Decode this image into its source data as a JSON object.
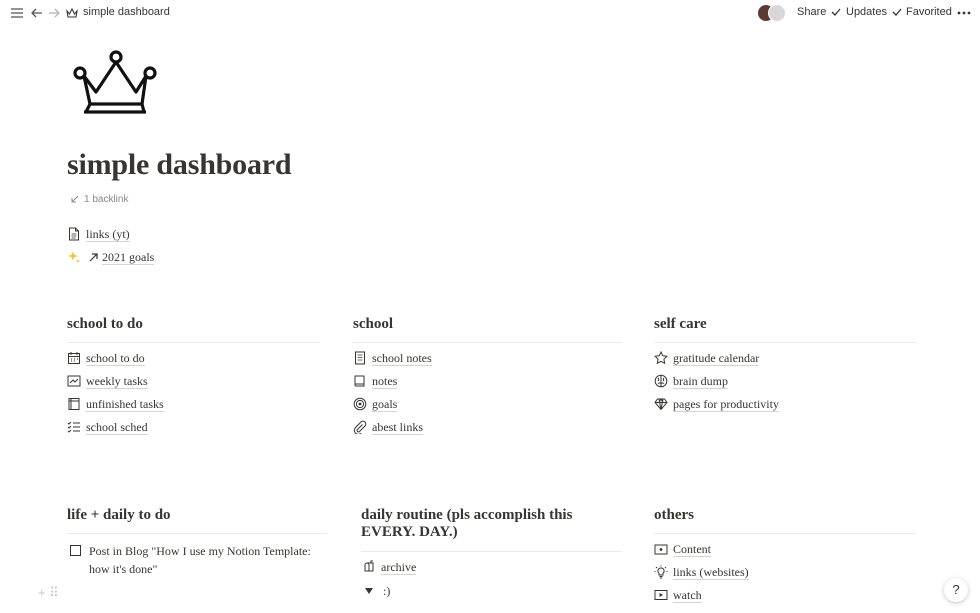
{
  "topbar": {
    "breadcrumb": "simple dashboard",
    "share": "Share",
    "updates": "Updates",
    "favorited": "Favorited"
  },
  "page": {
    "title": "simple dashboard",
    "backlink": "1 backlink",
    "links": [
      {
        "icon": "document-icon",
        "label": "links (yt)"
      },
      {
        "icon": "sparkles-icon",
        "label": "2021 goals"
      }
    ]
  },
  "sections": {
    "school_todo": {
      "heading": "school  to do",
      "items": [
        {
          "icon": "calendar-icon",
          "label": "school to do"
        },
        {
          "icon": "chart-icon",
          "label": "weekly tasks"
        },
        {
          "icon": "notebook-icon",
          "label": "unfinished tasks"
        },
        {
          "icon": "checklist-icon",
          "label": "school sched"
        }
      ]
    },
    "school": {
      "heading": "school",
      "items": [
        {
          "icon": "document-icon",
          "label": "school notes"
        },
        {
          "icon": "book-icon",
          "label": "notes"
        },
        {
          "icon": "target-icon",
          "label": "goals"
        },
        {
          "icon": "paperclip-icon",
          "label": "abest links"
        }
      ]
    },
    "self_care": {
      "heading": "self care",
      "items": [
        {
          "icon": "star-icon",
          "label": "gratitude calendar"
        },
        {
          "icon": "brain-icon",
          "label": "brain dump"
        },
        {
          "icon": "diamond-icon",
          "label": "pages for productivity"
        }
      ]
    },
    "life_daily": {
      "heading": "life +  daily to do",
      "todo": "Post in Blog \"How I use my Notion Template: how it's done\""
    },
    "daily_routine": {
      "heading_line1": "daily routine (pls accomplish this",
      "heading_line2": "EVERY. DAY.)",
      "archive": "archive",
      "toggle": ":)"
    },
    "others": {
      "heading": "others",
      "items": [
        {
          "icon": "content-icon",
          "label": "Content"
        },
        {
          "icon": "lightbulb-icon",
          "label": "links (websites)"
        },
        {
          "icon": "play-icon",
          "label": "watch"
        }
      ]
    }
  },
  "help": "?"
}
